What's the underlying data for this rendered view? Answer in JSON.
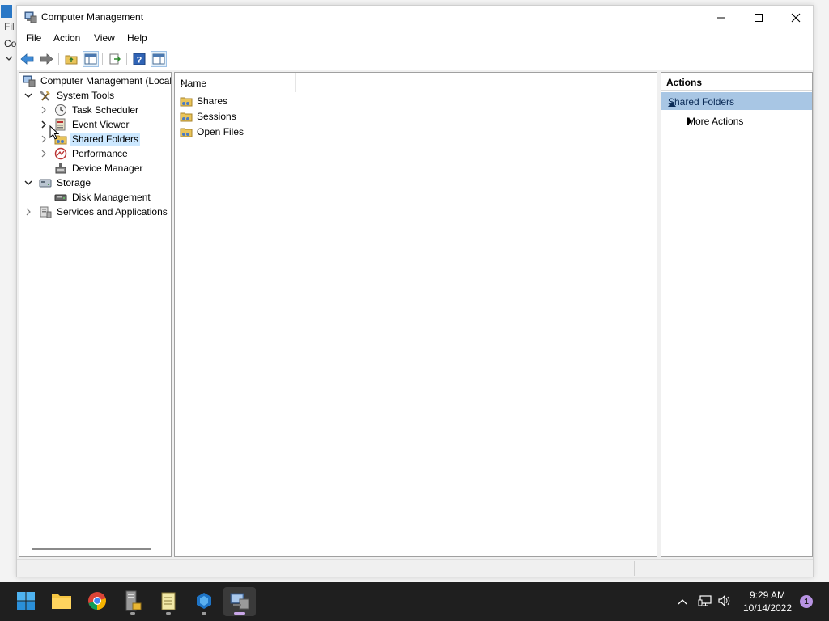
{
  "background_window": {
    "menu_fragment": "Fil",
    "tab_fragment": "Co"
  },
  "window": {
    "title": "Computer Management",
    "controls": {
      "minimize": "minimize",
      "maximize": "maximize",
      "close": "close"
    }
  },
  "menu": {
    "items": [
      "File",
      "Action",
      "View",
      "Help"
    ]
  },
  "toolbar": {
    "icons": [
      "back-arrow-icon",
      "forward-arrow-icon",
      "up-folder-icon",
      "show-hide-console-tree-icon",
      "export-list-icon",
      "help-icon",
      "show-hide-action-pane-icon"
    ]
  },
  "tree": {
    "root": "Computer Management (Local",
    "items": [
      {
        "label": "System Tools",
        "expanded": true
      },
      {
        "label": "Task Scheduler"
      },
      {
        "label": "Event Viewer"
      },
      {
        "label": "Shared Folders",
        "selected": true
      },
      {
        "label": "Performance"
      },
      {
        "label": "Device Manager"
      },
      {
        "label": "Storage",
        "expanded": true
      },
      {
        "label": "Disk Management"
      },
      {
        "label": "Services and Applications"
      }
    ]
  },
  "list": {
    "column_name": "Name",
    "rows": [
      "Shares",
      "Sessions",
      "Open Files"
    ]
  },
  "actions": {
    "header": "Actions",
    "section": "Shared Folders",
    "more_actions": "More Actions"
  },
  "taskbar": {
    "apps": [
      "start-icon",
      "file-explorer-icon",
      "chrome-icon",
      "server-manager-icon",
      "notepad-icon",
      "azure-icon",
      "computer-management-icon"
    ],
    "clock": {
      "time": "9:29 AM",
      "date": "10/14/2022"
    },
    "notification_count": "1"
  },
  "colors": {
    "selection": "#cce8ff",
    "action_section": "#a8c6e4",
    "taskbar": "#1f1f1f"
  }
}
